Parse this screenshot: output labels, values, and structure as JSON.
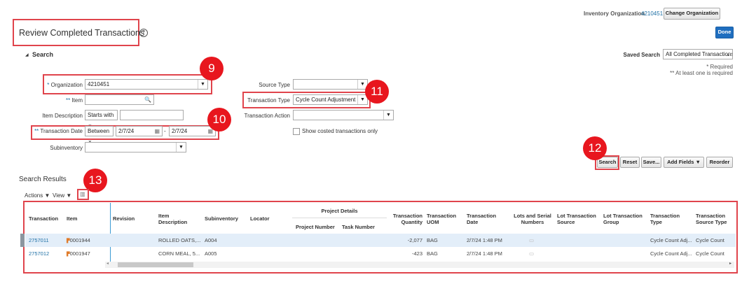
{
  "header": {
    "inv_org_label": "Inventory Organization",
    "inv_org_value": "4210451",
    "change_org": "Change Organization",
    "title": "Review Completed Transactions",
    "help": "?",
    "done": "Done"
  },
  "search": {
    "section": "Search",
    "saved_search_label": "Saved Search",
    "saved_search_value": "All Completed Transactions",
    "required": "* Required",
    "at_least_one": "** At least one is required",
    "org_label": "Organization",
    "org_value": "4210451",
    "item_label": "Item",
    "item_desc_label": "Item Description",
    "item_desc_op": "Starts with",
    "date_label": "Transaction Date",
    "date_op": "Between",
    "date_from": "2/7/24",
    "date_to": "2/7/24",
    "subinv_label": "Subinventory",
    "source_type_label": "Source Type",
    "trans_type_label": "Transaction Type",
    "trans_type_value": "Cycle Count Adjustment",
    "trans_action_label": "Transaction Action",
    "costed_label": "Show costed transactions only",
    "buttons": {
      "search": "Search",
      "reset": "Reset",
      "save": "Save...",
      "add_fields": "Add Fields",
      "reorder": "Reorder"
    }
  },
  "badges": [
    "9",
    "10",
    "11",
    "12",
    "13"
  ],
  "results": {
    "title": "Search Results",
    "actions": "Actions",
    "view": "View",
    "columns": {
      "transaction": "Transaction",
      "item": "Item",
      "revision": "Revision",
      "item_desc": "Item Description",
      "subinv": "Subinventory",
      "locator": "Locator",
      "project_details": "Project Details",
      "project_number": "Project Number",
      "task_number": "Task Number",
      "qty": "Transaction Quantity",
      "uom": "Transaction UOM",
      "date": "Transaction Date",
      "lots": "Lots and Serial Numbers",
      "lot_source": "Lot Transaction Source",
      "lot_group": "Lot Transaction Group",
      "type": "Transaction Type",
      "source_type": "Transaction Source Type"
    },
    "rows": [
      {
        "transaction": "2757011",
        "item": "0001944",
        "item_desc": "ROLLED OATS,...",
        "subinv": "A004",
        "qty": "-2,077",
        "uom": "BAG",
        "date": "2/7/24 1:48 PM",
        "type": "Cycle Count Adj...",
        "source_type": "Cycle Count"
      },
      {
        "transaction": "2757012",
        "item": "0001947",
        "item_desc": "CORN MEAL, 5...",
        "subinv": "A005",
        "qty": "-423",
        "uom": "BAG",
        "date": "2/7/24 1:48 PM",
        "type": "Cycle Count Adj...",
        "source_type": "Cycle Count"
      }
    ]
  }
}
